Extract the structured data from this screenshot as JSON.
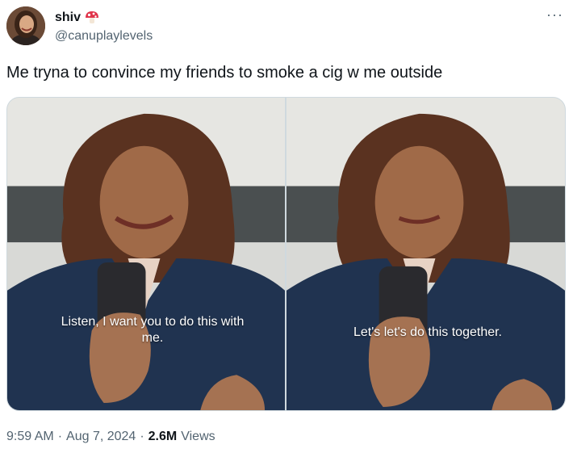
{
  "author": {
    "display_name": "shiv",
    "handle": "@canuplaylevels",
    "name_emoji": "mushroom-icon"
  },
  "tweet": {
    "text": "Me tryna to convince my friends to smoke a cig w me outside"
  },
  "media": {
    "panels": [
      {
        "caption": "Listen, I want you to do this with me."
      },
      {
        "caption": "Let's let's do this together."
      }
    ]
  },
  "meta": {
    "time": "9:59 AM",
    "separator": "·",
    "date": "Aug 7, 2024",
    "views_count": "2.6M",
    "views_label": "Views"
  },
  "menu": {
    "more_label": "···"
  },
  "colors": {
    "text_primary": "#0f1419",
    "text_secondary": "#536471",
    "border": "#cfd9de"
  }
}
